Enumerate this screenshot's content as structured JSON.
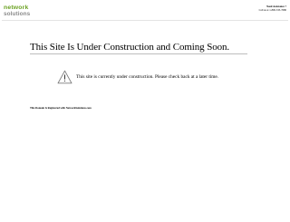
{
  "header": {
    "logo": {
      "line1": "network",
      "line2": "solutions"
    },
    "assistance": {
      "title": "Need Assistance ?",
      "phone": "Call us at 1-800-333-7680"
    }
  },
  "main": {
    "heading": "This Site Is Under Construction and Coming Soon.",
    "notice": "This site is currently under construction. Please check back at a later time.",
    "notice_icon": "warning-triangle-icon",
    "registered_note": "This Domain Is Registered with NetworkSolutions.com"
  },
  "colors": {
    "logo_green": "#6aa121",
    "logo_gray": "#8a8a8a",
    "rule": "#bdbdbd",
    "text": "#000000"
  }
}
